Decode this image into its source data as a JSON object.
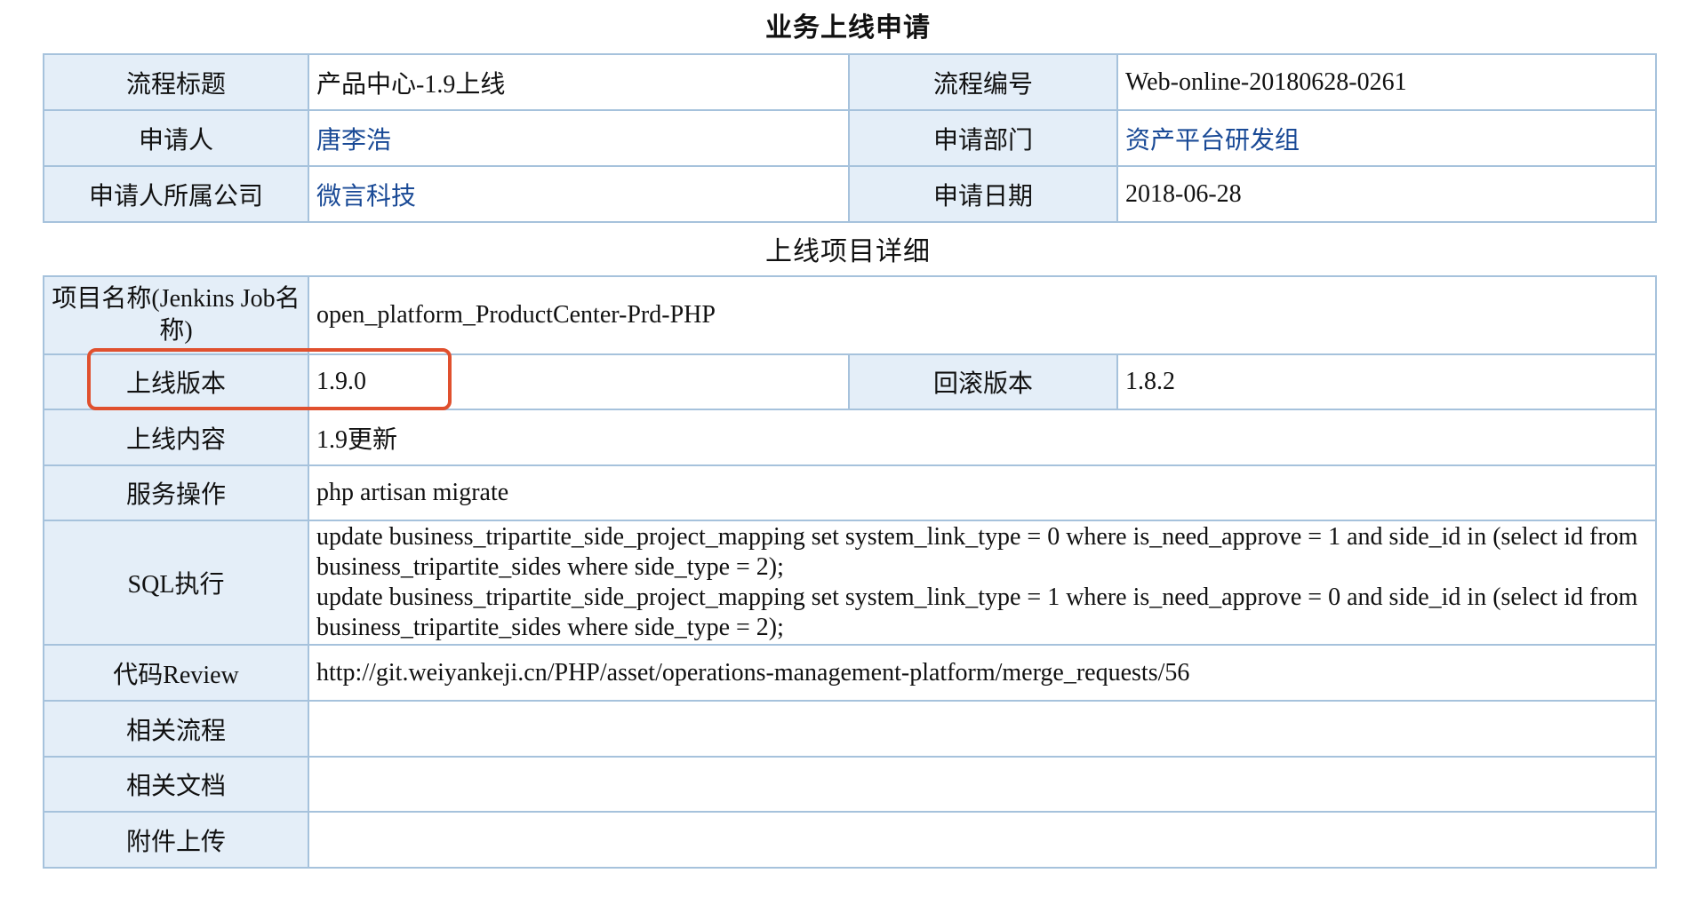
{
  "section1": {
    "title": "业务上线申请",
    "rows": [
      {
        "label1": "流程标题",
        "value1": "产品中心-1.9上线",
        "label2": "流程编号",
        "value2": "Web-online-20180628-0261"
      },
      {
        "label1": "申请人",
        "value1": "唐李浩",
        "label2": "申请部门",
        "value2": "资产平台研发组"
      },
      {
        "label1": "申请人所属公司",
        "value1": "微言科技",
        "label2": "申请日期",
        "value2": "2018-06-28"
      }
    ]
  },
  "section2": {
    "title": "上线项目详细",
    "project_name": {
      "label": "项目名称(Jenkins Job名称)",
      "value": "open_platform_ProductCenter-Prd-PHP"
    },
    "release_version": {
      "label": "上线版本",
      "value": "1.9.0"
    },
    "rollback_version": {
      "label": "回滚版本",
      "value": "1.8.2"
    },
    "release_content": {
      "label": "上线内容",
      "value": "1.9更新"
    },
    "service_operation": {
      "label": "服务操作",
      "value": "php artisan migrate"
    },
    "sql": {
      "label": "SQL执行",
      "lines": [
        "update business_tripartite_side_project_mapping set system_link_type = 0 where is_need_approve = 1 and side_id in (select id from business_tripartite_sides where side_type = 2);",
        "update business_tripartite_side_project_mapping set system_link_type = 1 where is_need_approve = 0 and side_id in (select id from business_tripartite_sides where side_type = 2);"
      ]
    },
    "code_review": {
      "label": "代码Review",
      "value": "http://git.weiyankeji.cn/PHP/asset/operations-management-platform/merge_requests/56"
    },
    "related_process": {
      "label": "相关流程",
      "value": ""
    },
    "related_docs": {
      "label": "相关文档",
      "value": ""
    },
    "attachments": {
      "label": "附件上传",
      "value": ""
    }
  },
  "colors": {
    "label_bg": "#e4eef8",
    "border": "#a6c2dc",
    "link": "#1a4a96",
    "highlight": "#e0502e"
  }
}
